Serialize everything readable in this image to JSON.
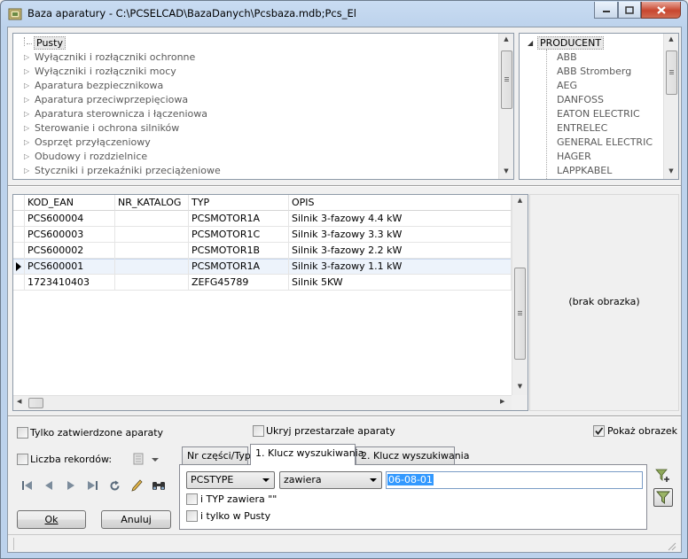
{
  "window": {
    "title": "Baza aparatury - C:\\PCSELCAD\\BazaDanych\\Pcsbaza.mdb;Pcs_El"
  },
  "categories": {
    "items": [
      {
        "label": "Pusty",
        "selected": true
      },
      {
        "label": "Wyłączniki i rozłączniki ochronne"
      },
      {
        "label": "Wyłączniki i rozłączniki mocy"
      },
      {
        "label": "Aparatura bezpiecznikowa"
      },
      {
        "label": "Aparatura przeciwprzepięciowa"
      },
      {
        "label": "Aparatura sterownicza i łączeniowa"
      },
      {
        "label": "Sterowanie i ochrona silników"
      },
      {
        "label": "Osprzęt przyłączeniowy"
      },
      {
        "label": "Obudowy i rozdzielnice"
      },
      {
        "label": "Styczniki i przekaźniki przeciążeniowe"
      }
    ]
  },
  "producers": {
    "root": "PRODUCENT",
    "items": [
      "ABB",
      "ABB Stromberg",
      "AEG",
      "DANFOSS",
      "EATON ELECTRIC",
      "ENTRELEC",
      "GENERAL ELECTRIC",
      "HAGER",
      "LAPPKABEL"
    ]
  },
  "grid": {
    "columns": [
      "KOD_EAN",
      "NR_KATALOG",
      "TYP",
      "OPIS"
    ],
    "rows": [
      [
        "PCS600004",
        "",
        "PCSMOTOR1A",
        "Silnik 3-fazowy 4.4 kW"
      ],
      [
        "PCS600003",
        "",
        "PCSMOTOR1C",
        "Silnik 3-fazowy 3.3 kW"
      ],
      [
        "PCS600002",
        "",
        "PCSMOTOR1B",
        "Silnik 3-fazowy 2.2 kW"
      ],
      [
        "PCS600001",
        "",
        "PCSMOTOR1A",
        "Silnik 3-fazowy 1.1 kW"
      ],
      [
        "1723410403",
        "",
        "ZEFG45789",
        "Silnik 5KW"
      ]
    ],
    "current_row_index": 3
  },
  "image_panel": {
    "text": "(brak obrazka)"
  },
  "options": {
    "only_approved": {
      "label": "Tylko zatwierdzone aparaty",
      "checked": false
    },
    "hide_obsolete": {
      "label": "Ukryj przestarzałe aparaty",
      "checked": false
    },
    "show_image": {
      "label": "Pokaż obrazek",
      "checked": true
    },
    "record_count": {
      "label": "Liczba rekordów:",
      "checked": false
    }
  },
  "buttons": {
    "ok": "Ok",
    "cancel": "Anuluj"
  },
  "tabs": [
    {
      "label": "Nr części/Typ",
      "active": false
    },
    {
      "label": "1. Klucz wyszukiwania",
      "active": true
    },
    {
      "label": "2. Klucz wyszukiwania",
      "active": false
    }
  ],
  "search": {
    "field": "PCSTYPE",
    "operator": "zawiera",
    "value": "06-08-01",
    "typ_contains": {
      "label": "i TYP zawiera \"\"",
      "checked": false
    },
    "only_in": {
      "label": "i tylko w Pusty",
      "checked": false
    }
  },
  "colors": {
    "selection": "#3399ff",
    "title_bg": "#bcd2ec",
    "close_btn": "#c8462f"
  },
  "icons": [
    "app-icon",
    "minimize-icon",
    "maximize-icon",
    "close-icon",
    "first-record-icon",
    "prior-record-icon",
    "next-record-icon",
    "last-record-icon",
    "refresh-icon",
    "edit-icon",
    "find-icon",
    "filter-add-icon",
    "filter-icon",
    "database-icon"
  ]
}
